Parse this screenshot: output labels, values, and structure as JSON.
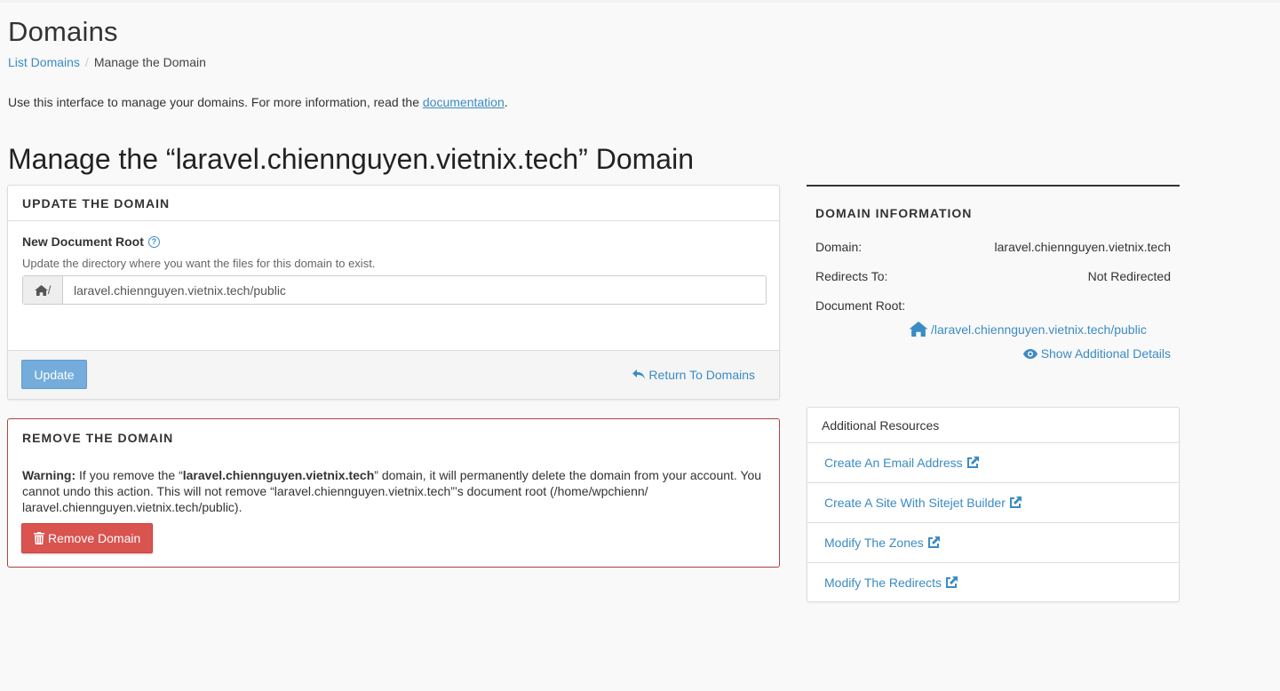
{
  "page": {
    "title": "Domains",
    "intro_prefix": "Use this interface to manage your domains. For more information, read the ",
    "intro_link": "documentation",
    "intro_suffix": ".",
    "manage_title": "Manage the “laravel.chiennguyen.vietnix.tech” Domain"
  },
  "breadcrumb": {
    "parent": "List Domains",
    "separator": "/",
    "current": "Manage the Domain"
  },
  "update_panel": {
    "heading": "UPDATE THE DOMAIN",
    "field_label": "New Document Root",
    "field_hint": "Update the directory where you want the files for this domain to exist.",
    "addon_text": "/",
    "input_value": "laravel.chiennguyen.vietnix.tech/public",
    "update_label": "Update",
    "return_label": "Return To Domains"
  },
  "remove_panel": {
    "heading": "REMOVE THE DOMAIN",
    "warning_label": "Warning:",
    "warning_pre": " If you remove the “",
    "warning_domain": "laravel.chiennguyen.vietnix.tech",
    "warning_post": "” domain, it will permanently delete the domain from your account. You cannot undo this action. This will not remove “laravel.chiennguyen.vietnix.tech”’s document root (/home/wpchienn/ laravel.chiennguyen.vietnix.tech/public).",
    "remove_label": "Remove Domain"
  },
  "domain_info": {
    "heading": "DOMAIN INFORMATION",
    "domain_label": "Domain:",
    "domain_value": "laravel.chiennguyen.vietnix.tech",
    "redirects_label": "Redirects To:",
    "redirects_value": "Not Redirected",
    "docroot_label": "Document Root:",
    "docroot_value": "/laravel.chiennguyen.vietnix.tech/public",
    "show_details_label": "Show Additional Details"
  },
  "resources": {
    "heading": "Additional Resources",
    "items": [
      {
        "label": "Create An Email Address"
      },
      {
        "label": "Create A Site With Sitejet Builder"
      },
      {
        "label": "Modify The Zones"
      },
      {
        "label": "Modify The Redirects"
      }
    ]
  },
  "colors": {
    "link": "#3b8bc4",
    "update_button": "#74acdc",
    "remove_button": "#d9534f",
    "remove_border": "#a94442"
  }
}
